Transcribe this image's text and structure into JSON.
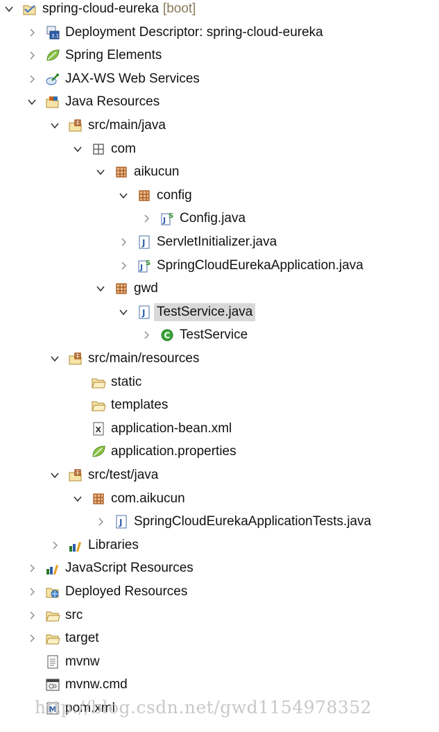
{
  "tree": {
    "nodes": [
      {
        "id": "project",
        "label": "spring-cloud-eureka",
        "suffix": "[boot]",
        "level": 0,
        "state": "expanded",
        "icon": "project-folder-icon"
      },
      {
        "id": "deployment-descriptor",
        "label": "Deployment Descriptor: spring-cloud-eureka",
        "level": 1,
        "state": "collapsed",
        "icon": "deployment-descriptor-icon"
      },
      {
        "id": "spring-elements",
        "label": "Spring Elements",
        "level": 1,
        "state": "collapsed",
        "icon": "spring-leaf-icon"
      },
      {
        "id": "jaxws",
        "label": "JAX-WS Web Services",
        "level": 1,
        "state": "collapsed",
        "icon": "web-services-icon"
      },
      {
        "id": "java-resources",
        "label": "Java Resources",
        "level": 1,
        "state": "expanded",
        "icon": "java-resources-icon"
      },
      {
        "id": "src-main-java",
        "label": "src/main/java",
        "level": 2,
        "state": "expanded",
        "icon": "source-folder-icon"
      },
      {
        "id": "pkg-com",
        "label": "com",
        "level": 3,
        "state": "expanded",
        "icon": "empty-package-icon"
      },
      {
        "id": "pkg-aikucun",
        "label": "aikucun",
        "level": 4,
        "state": "expanded",
        "icon": "package-icon"
      },
      {
        "id": "pkg-config",
        "label": "config",
        "level": 5,
        "state": "expanded",
        "icon": "package-icon"
      },
      {
        "id": "config-java",
        "label": "Config.java",
        "level": 6,
        "state": "collapsed",
        "icon": "spring-java-file-icon"
      },
      {
        "id": "servlet-initializer",
        "label": "ServletInitializer.java",
        "level": 5,
        "state": "collapsed",
        "icon": "java-file-icon"
      },
      {
        "id": "app-java",
        "label": "SpringCloudEurekaApplication.java",
        "level": 5,
        "state": "collapsed",
        "icon": "spring-java-file-icon"
      },
      {
        "id": "pkg-gwd",
        "label": "gwd",
        "level": 4,
        "state": "expanded",
        "icon": "package-icon"
      },
      {
        "id": "testservice-java",
        "label": "TestService.java",
        "level": 5,
        "state": "expanded",
        "icon": "java-file-icon",
        "selected": true
      },
      {
        "id": "testservice-class",
        "label": "TestService",
        "level": 6,
        "state": "collapsed",
        "icon": "class-icon"
      },
      {
        "id": "src-main-resources",
        "label": "src/main/resources",
        "level": 2,
        "state": "expanded",
        "icon": "source-folder-icon"
      },
      {
        "id": "static",
        "label": "static",
        "level": 3,
        "state": "leaf",
        "icon": "folder-icon"
      },
      {
        "id": "templates",
        "label": "templates",
        "level": 3,
        "state": "leaf",
        "icon": "folder-icon"
      },
      {
        "id": "application-bean",
        "label": "application-bean.xml",
        "level": 3,
        "state": "leaf",
        "icon": "xml-file-icon"
      },
      {
        "id": "application-properties",
        "label": "application.properties",
        "level": 3,
        "state": "leaf",
        "icon": "spring-leaf-icon"
      },
      {
        "id": "src-test-java",
        "label": "src/test/java",
        "level": 2,
        "state": "expanded",
        "icon": "source-folder-icon"
      },
      {
        "id": "pkg-com-aikucun",
        "label": "com.aikucun",
        "level": 3,
        "state": "expanded",
        "icon": "package-icon"
      },
      {
        "id": "tests-java",
        "label": "SpringCloudEurekaApplicationTests.java",
        "level": 4,
        "state": "collapsed",
        "icon": "java-file-icon"
      },
      {
        "id": "libraries",
        "label": "Libraries",
        "level": 2,
        "state": "collapsed",
        "icon": "libraries-icon"
      },
      {
        "id": "js-resources",
        "label": "JavaScript Resources",
        "level": 1,
        "state": "collapsed",
        "icon": "libraries-icon"
      },
      {
        "id": "deployed-resources",
        "label": "Deployed Resources",
        "level": 1,
        "state": "collapsed",
        "icon": "deployed-resources-icon"
      },
      {
        "id": "src",
        "label": "src",
        "level": 1,
        "state": "collapsed",
        "icon": "folder-icon"
      },
      {
        "id": "target",
        "label": "target",
        "level": 1,
        "state": "collapsed",
        "icon": "folder-icon"
      },
      {
        "id": "mvnw",
        "label": "mvnw",
        "level": 1,
        "state": "leaf",
        "icon": "text-file-icon"
      },
      {
        "id": "mvnw-cmd",
        "label": "mvnw.cmd",
        "level": 1,
        "state": "leaf",
        "icon": "cmd-file-icon"
      },
      {
        "id": "pom-xml",
        "label": "pom.xml",
        "level": 1,
        "state": "leaf",
        "icon": "maven-pom-icon"
      }
    ]
  },
  "watermark": "http://blog.csdn.net/gwd1154978352"
}
